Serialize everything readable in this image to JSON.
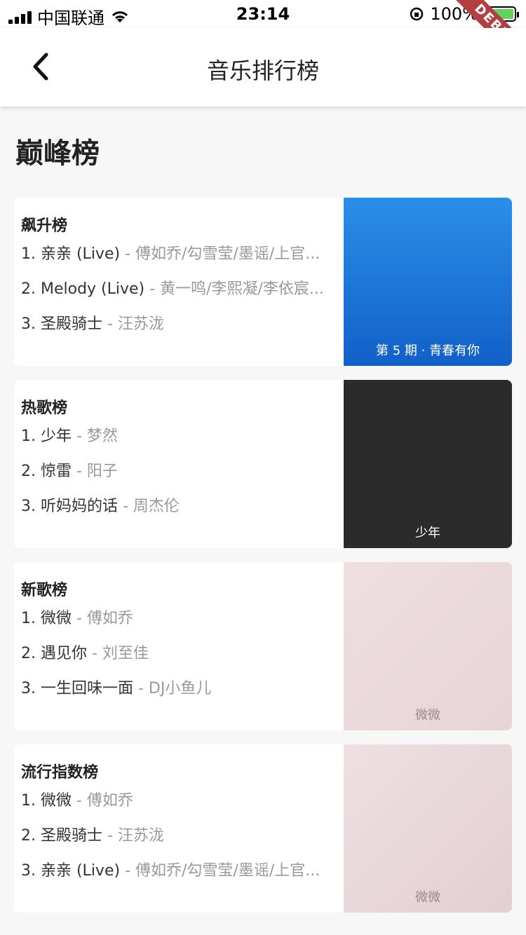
{
  "status": {
    "carrier": "中国联通",
    "time": "23:14",
    "battery": "100%"
  },
  "ribbon": "DEBUG",
  "nav": {
    "title": "音乐排行榜"
  },
  "section_title": "巅峰榜",
  "cards": [
    {
      "label": "飙升榜",
      "songs": [
        {
          "prefix": "1. 亲亲 (Live)",
          "artist": " - 傅如乔/勾雪莹/墨谣/上官..."
        },
        {
          "prefix": "2. Melody (Live)",
          "artist": " - 黄一鸣/李熙凝/李依宸..."
        },
        {
          "prefix": "3. 圣殿骑士",
          "artist": " - 汪苏泷"
        }
      ],
      "cover_text": "第 5 期 · 青春有你"
    },
    {
      "label": "热歌榜",
      "songs": [
        {
          "prefix": "1. 少年",
          "artist": " - 梦然"
        },
        {
          "prefix": "2. 惊雷",
          "artist": " - 阳子"
        },
        {
          "prefix": "3. 听妈妈的话",
          "artist": " - 周杰伦"
        }
      ],
      "cover_text": "少年"
    },
    {
      "label": "新歌榜",
      "songs": [
        {
          "prefix": "1. 微微",
          "artist": " - 傅如乔"
        },
        {
          "prefix": "2. 遇见你",
          "artist": " - 刘至佳"
        },
        {
          "prefix": "3. 一生回味一面",
          "artist": " - DJ小鱼儿"
        }
      ],
      "cover_text": "微微"
    },
    {
      "label": "流行指数榜",
      "songs": [
        {
          "prefix": "1. 微微",
          "artist": " - 傅如乔"
        },
        {
          "prefix": "2. 圣殿骑士",
          "artist": " - 汪苏泷"
        },
        {
          "prefix": "3. 亲亲 (Live)",
          "artist": " - 傅如乔/勾雪莹/墨谣/上官..."
        }
      ],
      "cover_text": "微微"
    }
  ]
}
